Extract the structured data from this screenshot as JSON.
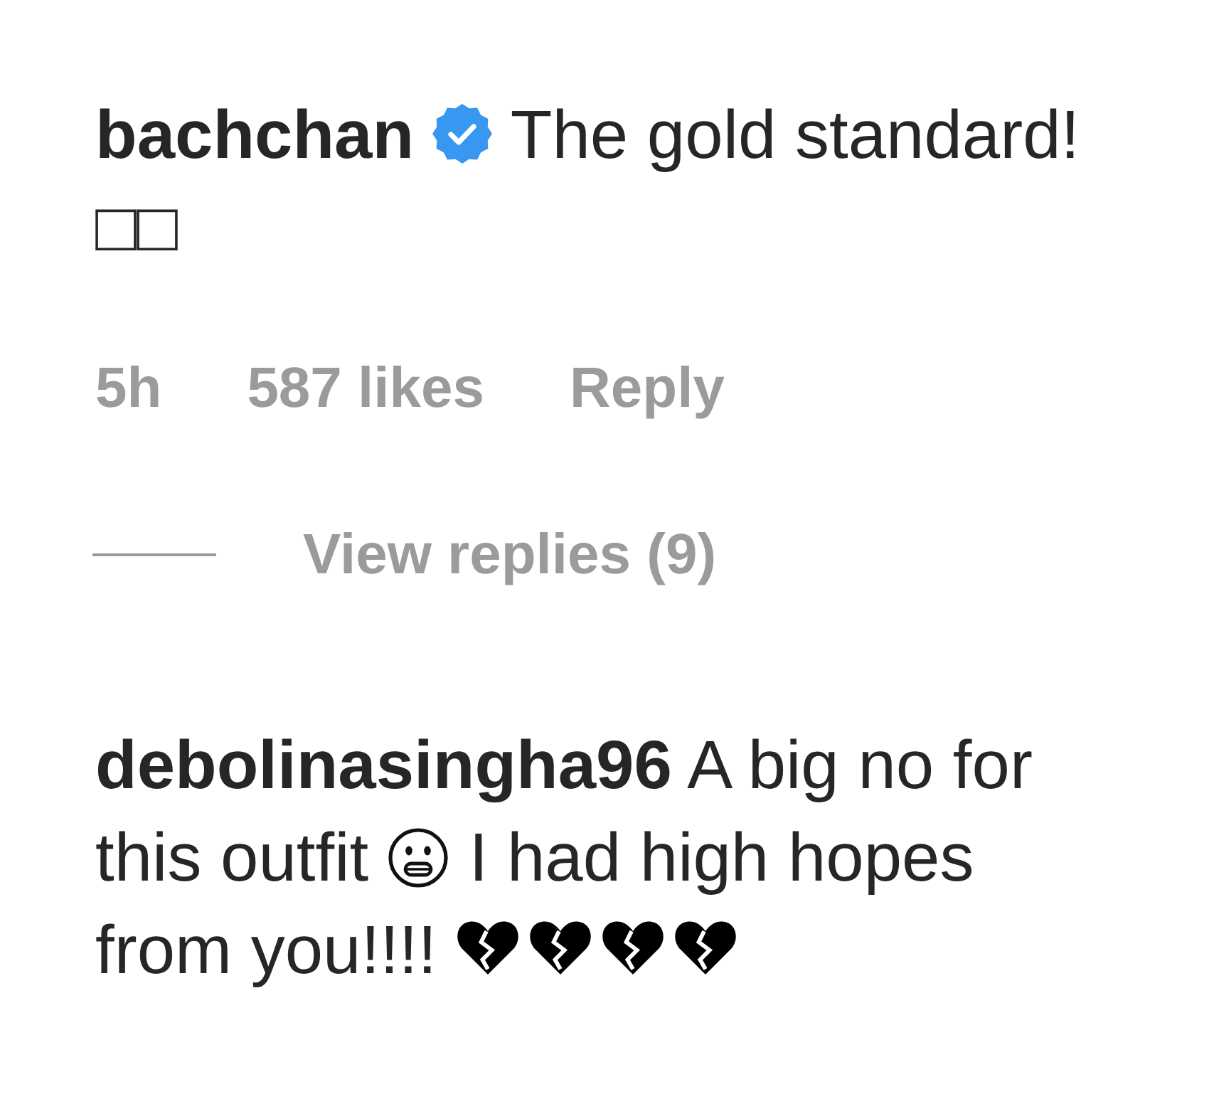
{
  "comments": [
    {
      "username": "bachchan",
      "verified": true,
      "body": [
        {
          "kind": "text",
          "text": "The gold standard! □□"
        }
      ],
      "time": "5h",
      "likes": "587 likes",
      "reply": "Reply",
      "view_replies": "View replies (9)"
    },
    {
      "username": "debolinasingha96",
      "verified": false,
      "body": [
        {
          "kind": "text",
          "text": "A big no for this outfit"
        },
        {
          "kind": "face_emoji"
        },
        {
          "kind": "text",
          "text": "I had high hopes from you!!!!"
        },
        {
          "kind": "broken_heart_emoji"
        },
        {
          "kind": "broken_heart_emoji"
        },
        {
          "kind": "broken_heart_emoji"
        },
        {
          "kind": "broken_heart_emoji"
        }
      ]
    }
  ]
}
